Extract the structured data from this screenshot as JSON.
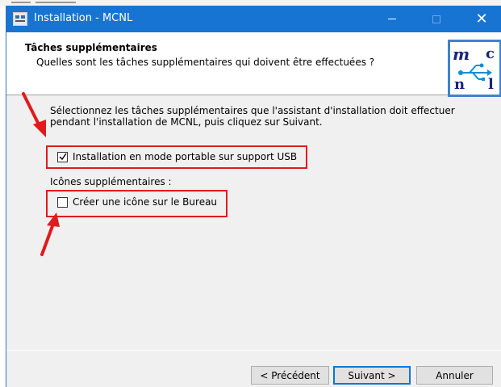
{
  "window": {
    "title": "Installation - MCNL",
    "controls": {
      "minimize": "minimize-icon",
      "maximize": "maximize-icon",
      "close": "close-icon"
    }
  },
  "header": {
    "title": "Tâches supplémentaires",
    "subtitle": "Quelles sont les tâches supplémentaires qui doivent être effectuées ?",
    "logo": {
      "letters": [
        "m",
        "c",
        "n",
        "l"
      ],
      "icon": "usb-icon"
    }
  },
  "main": {
    "instructions": "Sélectionnez les tâches supplémentaires que l'assistant d'installation doit effectuer pendant l'installation de MCNL, puis cliquez sur Suivant.",
    "tasks": [
      {
        "label": "Installation en mode portable sur support USB",
        "checked": true
      }
    ],
    "icons_section_label": "Icônes supplémentaires :",
    "icon_tasks": [
      {
        "label": "Créer une icône sur le Bureau",
        "checked": false
      }
    ]
  },
  "buttons": {
    "back": "< Précédent",
    "next": "Suivant >",
    "cancel": "Annuler"
  },
  "colors": {
    "titlebar": "#1874d2",
    "annotation": "#e01b1b",
    "focus": "#0078d7"
  }
}
